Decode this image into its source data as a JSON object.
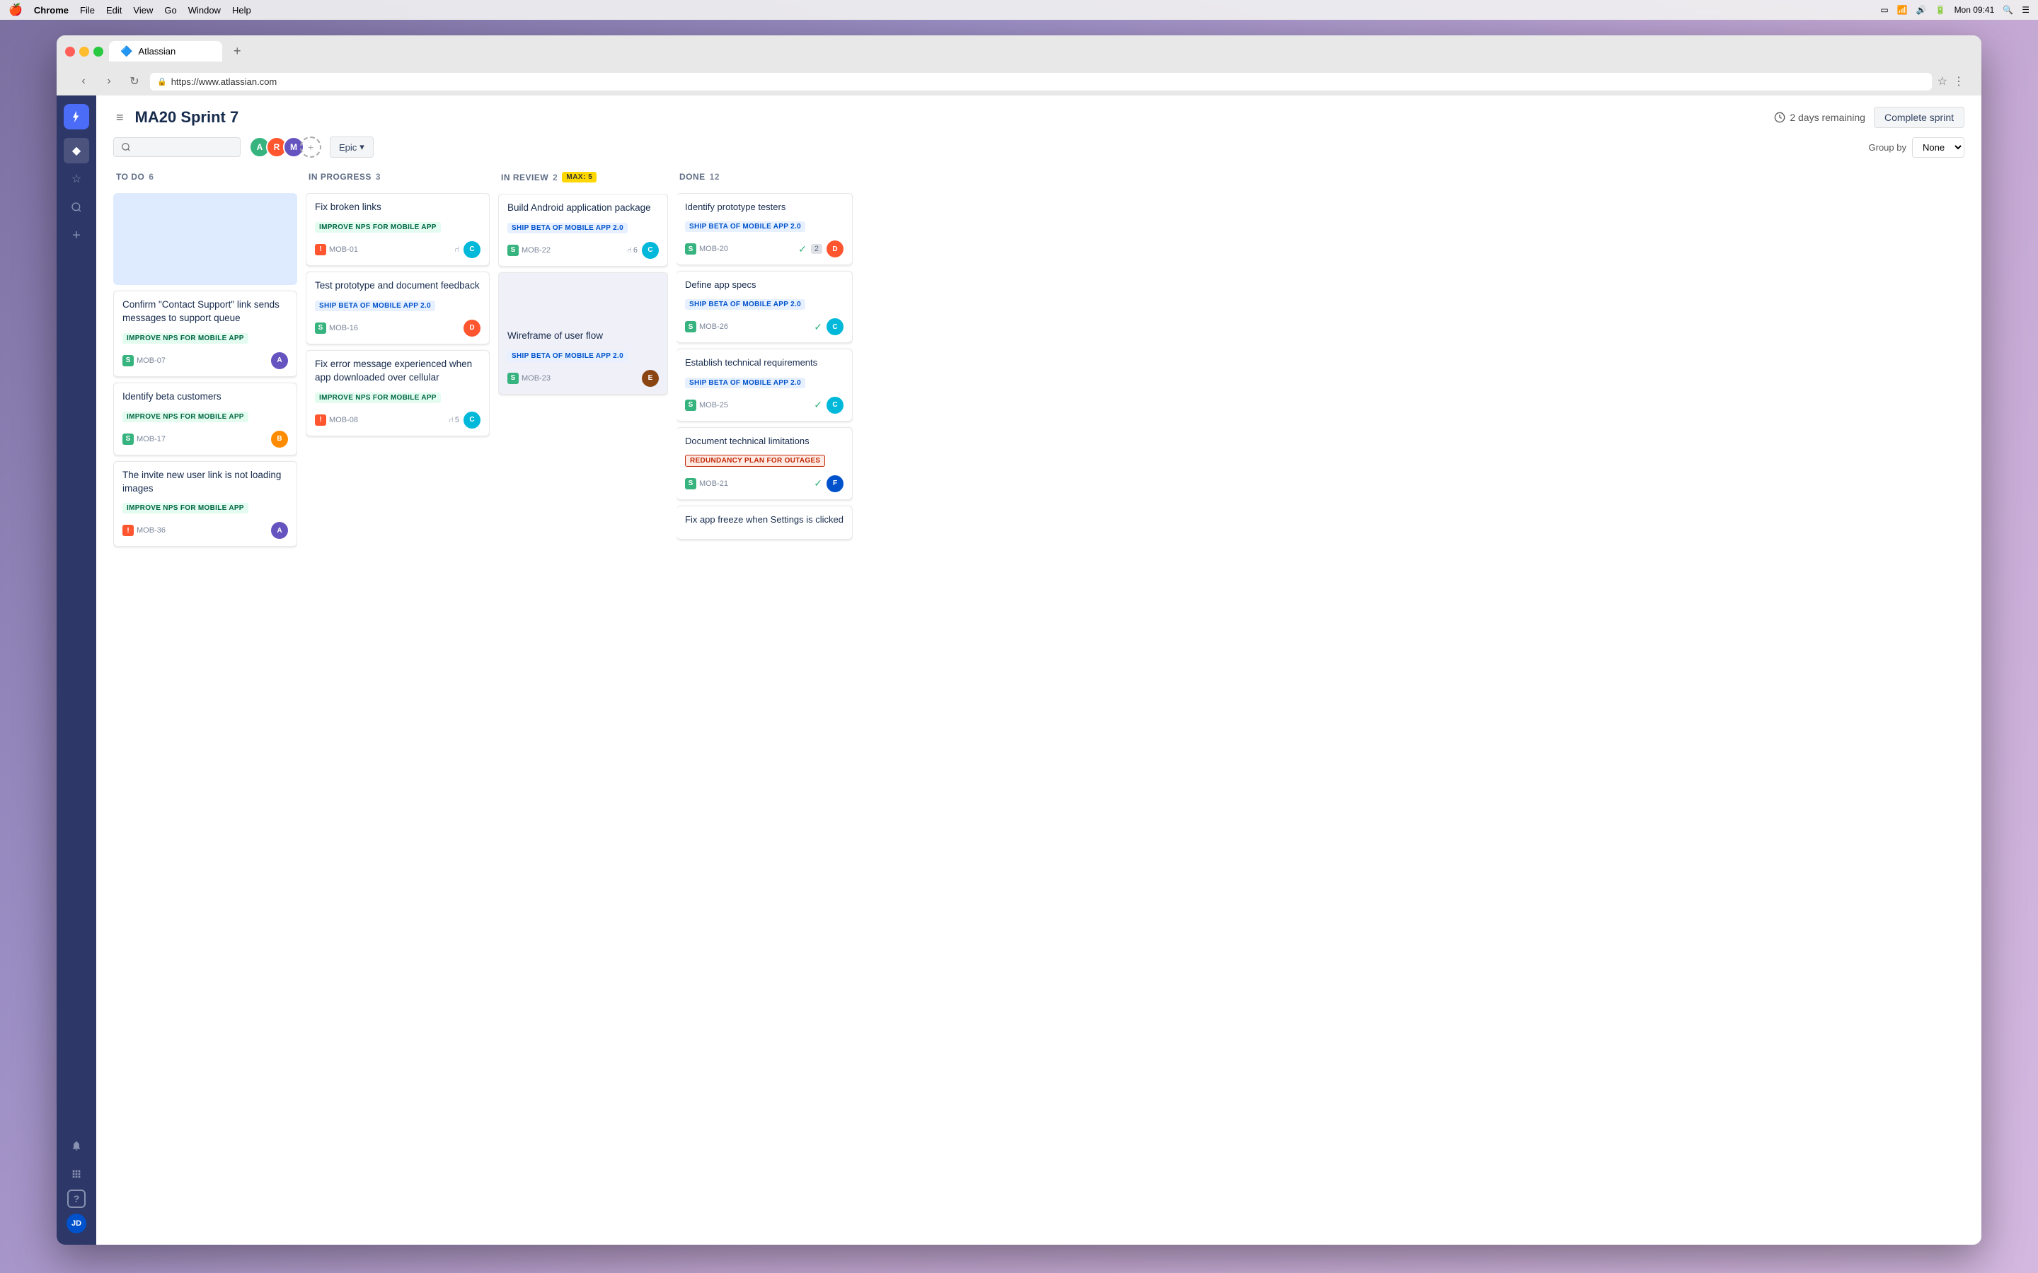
{
  "menubar": {
    "apple": "🍎",
    "app": "Chrome",
    "menus": [
      "File",
      "Edit",
      "View",
      "Go",
      "Window",
      "Help"
    ],
    "time": "Mon 09:41"
  },
  "browser": {
    "tab_title": "Atlassian",
    "tab_icon": "🔷",
    "url": "https://www.atlassian.com",
    "new_tab_label": "+"
  },
  "sidebar": {
    "nav_items": [
      {
        "name": "home",
        "icon": "◆"
      },
      {
        "name": "star",
        "icon": "☆"
      },
      {
        "name": "search",
        "icon": "🔍"
      },
      {
        "name": "add",
        "icon": "+"
      }
    ],
    "bottom_items": [
      {
        "name": "notifications",
        "icon": "🔔"
      },
      {
        "name": "apps",
        "icon": "⊞"
      },
      {
        "name": "help",
        "icon": "?"
      },
      {
        "name": "profile",
        "icon": "👤"
      }
    ]
  },
  "header": {
    "sprint_title": "MA20 Sprint 7",
    "days_remaining": "2 days remaining",
    "complete_sprint_btn": "Complete sprint"
  },
  "toolbar": {
    "search_placeholder": "Search",
    "epic_filter": "Epic",
    "group_by_label": "Group by",
    "group_by_value": "None"
  },
  "columns": [
    {
      "id": "todo",
      "title": "TO DO",
      "count": "6",
      "max": null,
      "cards": [
        {
          "type": "placeholder",
          "is_placeholder": true
        },
        {
          "title": "Confirm \"Contact Support\" link sends messages to support queue",
          "epic": "IMPROVE NPS FOR MOBILE APP",
          "epic_type": "improve",
          "card_type": "story",
          "id": "MOB-07",
          "avatar_color": "#6554c0",
          "avatar_initial": "A",
          "story_points": null
        },
        {
          "title": "Identify beta customers",
          "epic": "IMPROVE NPS FOR MOBILE APP",
          "epic_type": "improve",
          "card_type": "story",
          "id": "MOB-17",
          "avatar_color": "#ff8b00",
          "avatar_initial": "B",
          "story_points": null
        },
        {
          "title": "The invite new user link is not loading images",
          "epic": "IMPROVE NPS FOR MOBILE APP",
          "epic_type": "improve",
          "card_type": "bug",
          "id": "MOB-36",
          "avatar_color": "#6554c0",
          "avatar_initial": "A",
          "story_points": null
        }
      ]
    },
    {
      "id": "inprogress",
      "title": "IN PROGRESS",
      "count": "3",
      "max": null,
      "cards": [
        {
          "title": "Fix broken links",
          "epic": "IMPROVE NPS FOR MOBILE APP",
          "epic_type": "improve",
          "card_type": "bug",
          "id": "MOB-01",
          "avatar_color": "#00b8d9",
          "avatar_initial": "C",
          "story_points": null,
          "has_branch": true
        },
        {
          "title": "Test prototype and document feedback",
          "epic": "SHIP BETA OF MOBILE APP 2.0",
          "epic_type": "ship",
          "card_type": "story",
          "id": "MOB-16",
          "avatar_color": "#ff5630",
          "avatar_initial": "D",
          "story_points": null
        },
        {
          "title": "Fix error message experienced when app downloaded over cellular",
          "epic": "IMPROVE NPS FOR MOBILE APP",
          "epic_type": "improve",
          "card_type": "bug",
          "id": "MOB-08",
          "avatar_color": "#00b8d9",
          "avatar_initial": "C",
          "story_points": "5",
          "has_branch": true
        }
      ]
    },
    {
      "id": "inreview",
      "title": "IN REVIEW",
      "count": "2",
      "max": "MAX: 5",
      "cards": [
        {
          "title": "Build Android application package",
          "epic": "SHIP BETA OF MOBILE APP 2.0",
          "epic_type": "ship",
          "card_type": "story",
          "id": "MOB-22",
          "avatar_color": "#00b8d9",
          "avatar_initial": "C",
          "story_points": "6",
          "has_branch": true
        },
        {
          "title": "Wireframe of user flow",
          "epic": "SHIP BETA OF MOBILE APP 2.0",
          "epic_type": "ship",
          "card_type": "story",
          "id": "MOB-23",
          "avatar_color": "#8b4513",
          "avatar_initial": "E",
          "story_points": null
        }
      ]
    },
    {
      "id": "done",
      "title": "DONE",
      "count": "12",
      "max": null,
      "cards": [
        {
          "title": "Identify prototype testers",
          "epic": "SHIP BETA OF MOBILE APP 2.0",
          "epic_type": "ship",
          "card_type": "story",
          "id": "MOB-20",
          "avatar_color": "#ff5630",
          "avatar_initial": "D",
          "done": true,
          "count_badge": "2"
        },
        {
          "title": "Define app specs",
          "epic": "SHIP BETA OF MOBILE APP 2.0",
          "epic_type": "ship",
          "card_type": "story",
          "id": "MOB-26",
          "avatar_color": "#00b8d9",
          "avatar_initial": "C",
          "done": true
        },
        {
          "title": "Establish technical requirements",
          "epic": "SHIP BETA OF MOBILE APP 2.0",
          "epic_type": "ship",
          "card_type": "story",
          "id": "MOB-25",
          "avatar_color": "#00b8d9",
          "avatar_initial": "C",
          "done": true
        },
        {
          "title": "Document technical limitations",
          "epic": "REDUNDANCY PLAN FOR OUTAGES",
          "epic_type": "redundancy",
          "card_type": "story",
          "id": "MOB-21",
          "avatar_color": "#0052cc",
          "avatar_initial": "F",
          "done": true
        },
        {
          "title": "Fix app freeze when Settings is clicked",
          "epic": null,
          "epic_type": null,
          "card_type": "bug",
          "id": null,
          "done": true
        }
      ]
    }
  ],
  "avatars": [
    {
      "color": "#36b37e",
      "initial": "A"
    },
    {
      "color": "#ff5630",
      "initial": "R"
    },
    {
      "color": "#6554c0",
      "initial": "M"
    }
  ]
}
